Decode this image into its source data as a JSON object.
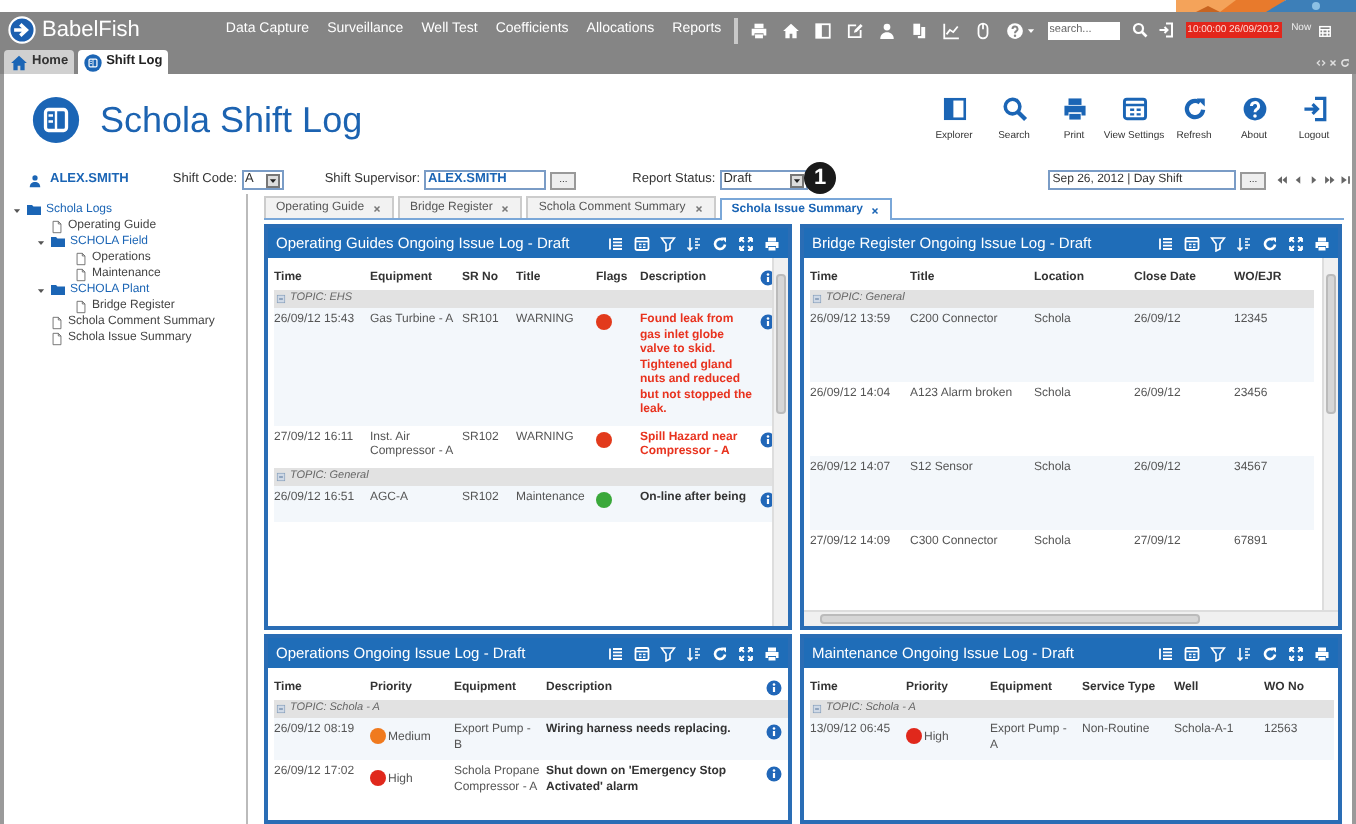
{
  "app": {
    "name": "BabelFish",
    "menu": [
      "Data Capture",
      "Surveillance",
      "Well Test",
      "Coefficients",
      "Allocations",
      "Reports"
    ],
    "search": {
      "placeholder": "search..."
    },
    "clock": "10:00:00 26/09/2012",
    "now": "Now"
  },
  "window_tabs": [
    {
      "label": "Home",
      "selected": false
    },
    {
      "label": "Shift Log",
      "selected": true
    }
  ],
  "page": {
    "title": "Schola Shift Log",
    "actions": [
      "Explorer",
      "Search",
      "Print",
      "View Settings",
      "Refresh",
      "About",
      "Logout"
    ]
  },
  "toolbar": {
    "user": "ALEX.SMITH",
    "shift_code": {
      "label": "Shift Code:",
      "value": "A"
    },
    "shift_supervisor": {
      "label": "Shift Supervisor:",
      "value": "ALEX.SMITH",
      "button": "..."
    },
    "report_status": {
      "label": "Report Status:",
      "value": "Draft"
    },
    "shift": {
      "value": "Sep 26, 2012 | Day Shift",
      "button": "..."
    }
  },
  "callout": "1",
  "tree": [
    {
      "label": "Schola Logs",
      "expanded": true,
      "children": [
        {
          "label": "Operating Guide"
        },
        {
          "label": "SCHOLA Field",
          "expanded": true,
          "children": [
            {
              "label": "Operations"
            },
            {
              "label": "Maintenance"
            }
          ]
        },
        {
          "label": "SCHOLA Plant",
          "expanded": true,
          "children": [
            {
              "label": "Bridge Register"
            }
          ]
        },
        {
          "label": "Schola Comment Summary"
        },
        {
          "label": "Schola Issue Summary"
        }
      ]
    }
  ],
  "tabs": [
    {
      "label": "Operating Guide",
      "selected": false
    },
    {
      "label": "Bridge Register",
      "selected": false
    },
    {
      "label": "Schola Comment Summary",
      "selected": false
    },
    {
      "label": "Schola Issue Summary",
      "selected": true
    }
  ],
  "panels": [
    {
      "title": "Operating Guides Ongoing Issue Log - Draft",
      "columns": [
        {
          "label": "Time",
          "kind": "text"
        },
        {
          "label": "Equipment",
          "kind": "text"
        },
        {
          "label": "SR No",
          "kind": "text"
        },
        {
          "label": "Title",
          "kind": "text"
        },
        {
          "label": "Flags",
          "kind": "flag"
        },
        {
          "label": "Description",
          "kind": "description"
        }
      ],
      "info_column": true,
      "vertical_scroll": true,
      "groups": [
        {
          "topic": "TOPIC: EHS",
          "rows": [
            {
              "cells": [
                "26/09/12 15:43",
                "Gas Turbine - A",
                "SR101",
                "WARNING",
                {
                  "color": "#e23a1c"
                },
                {
                  "text": "Found leak from gas inlet globe valve to skid. Tightened gland nuts and reduced but not stopped the leak.",
                  "color": "#e8321e"
                }
              ]
            },
            {
              "cells": [
                "27/09/12 16:11",
                "Inst. Air Compressor - A",
                "SR102",
                "WARNING",
                {
                  "color": "#e23a1c"
                },
                {
                  "text": "Spill Hazard near Compressor - A",
                  "color": "#e8321e"
                }
              ]
            }
          ]
        },
        {
          "topic": "TOPIC: General",
          "rows": [
            {
              "cells": [
                "26/09/12 16:51",
                "AGC-A",
                "SR102",
                "Maintenance",
                {
                  "color": "#3aa83a"
                },
                {
                  "text": "On-line after being"
                }
              ]
            }
          ]
        }
      ]
    },
    {
      "title": "Bridge Register Ongoing Issue Log - Draft",
      "columns": [
        {
          "label": "Time",
          "kind": "text"
        },
        {
          "label": "Title",
          "kind": "text"
        },
        {
          "label": "Location",
          "kind": "text"
        },
        {
          "label": "Close Date",
          "kind": "text"
        },
        {
          "label": "WO/EJR",
          "kind": "text"
        }
      ],
      "vertical_scroll": true,
      "horizontal_scroll": true,
      "groups": [
        {
          "topic": "TOPIC: General",
          "rows": [
            {
              "cells": [
                "26/09/12 13:59",
                "C200 Connector",
                "Schola",
                "26/09/12",
                "12345"
              ]
            },
            {
              "cells": [
                "26/09/12 14:04",
                "A123 Alarm broken",
                "Schola",
                "26/09/12",
                "23456"
              ]
            },
            {
              "cells": [
                "26/09/12 14:07",
                "S12 Sensor",
                "Schola",
                "26/09/12",
                "34567"
              ]
            },
            {
              "cells": [
                "27/09/12 14:09",
                "C300 Connector",
                "Schola",
                "27/09/12",
                "67891"
              ]
            }
          ]
        }
      ]
    },
    {
      "title": "Operations Ongoing Issue Log - Draft",
      "columns": [
        {
          "label": "Time",
          "kind": "text"
        },
        {
          "label": "Priority",
          "kind": "priority"
        },
        {
          "label": "Equipment",
          "kind": "text"
        },
        {
          "label": "Description",
          "kind": "description"
        }
      ],
      "info_column": true,
      "groups": [
        {
          "topic": "TOPIC: Schola - A",
          "rows": [
            {
              "cells": [
                "26/09/12 08:19",
                {
                  "text": "Medium",
                  "color": "#f07a1e"
                },
                "Export Pump - B",
                {
                  "text": "Wiring harness needs replacing."
                }
              ]
            },
            {
              "cells": [
                "26/09/12 17:02",
                {
                  "text": "High",
                  "color": "#e0281c"
                },
                "Schola Propane Compressor - A",
                {
                  "text": "Shut down on 'Emergency Stop Activated' alarm"
                }
              ]
            }
          ]
        }
      ]
    },
    {
      "title": "Maintenance Ongoing Issue Log - Draft",
      "columns": [
        {
          "label": "Time",
          "kind": "text"
        },
        {
          "label": "Priority",
          "kind": "priority"
        },
        {
          "label": "Equipment",
          "kind": "text"
        },
        {
          "label": "Service Type",
          "kind": "text"
        },
        {
          "label": "Well",
          "kind": "text"
        },
        {
          "label": "WO No",
          "kind": "text"
        }
      ],
      "groups": [
        {
          "topic": "TOPIC: Schola - A",
          "rows": [
            {
              "cells": [
                "13/09/12 06:45",
                {
                  "text": "High",
                  "color": "#e0281c"
                },
                "Export Pump - A",
                "Non-Routine",
                "Schola-A-1",
                "12563"
              ]
            }
          ]
        }
      ]
    }
  ]
}
